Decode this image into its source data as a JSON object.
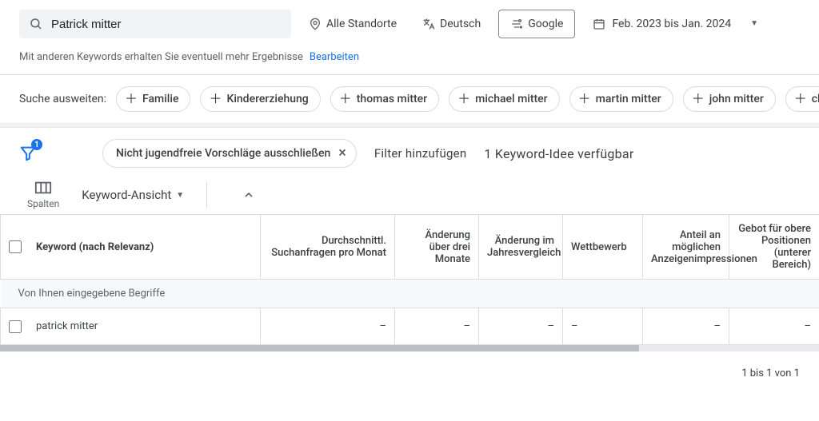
{
  "search": {
    "value": "Patrick mitter"
  },
  "targets": {
    "location": "Alle Standorte",
    "language": "Deutsch",
    "network": "Google",
    "date_range": "Feb. 2023 bis Jan. 2024"
  },
  "hint": {
    "text": "Mit anderen Keywords erhalten Sie eventuell mehr Ergebnisse",
    "edit": "Bearbeiten"
  },
  "expand": {
    "label": "Suche ausweiten:",
    "chips": [
      "Familie",
      "Kindererziehung",
      "thomas mitter",
      "michael mitter",
      "martin mitter",
      "john mitter",
      "christian"
    ]
  },
  "filters": {
    "badge": "1",
    "applied": "Nicht jugendfreie Vorschläge ausschließen",
    "add": "Filter hinzufügen",
    "ideas": "1 Keyword-Idee verfügbar"
  },
  "controls": {
    "columns": "Spalten",
    "view": "Keyword-Ansicht"
  },
  "table": {
    "headers": {
      "keyword": "Keyword (nach Relevanz)",
      "avg": "Durchschnittl. Suchanfragen pro Monat",
      "change3": "Änderung über drei Monate",
      "changeYoY": "Änderung im Jahresvergleich",
      "competition": "Wettbewerb",
      "impShare": "Anteil an möglichen Anzeigenimpressionen",
      "bidTop": "Gebot für obere Positionen (unterer Bereich)"
    },
    "section": "Von Ihnen eingegebene Begriffe",
    "rows": [
      {
        "keyword": "patrick mitter",
        "avg": "–",
        "change3": "–",
        "changeYoY": "–",
        "competition": "–",
        "impShare": "–",
        "bidTop": "–"
      }
    ]
  },
  "pager": "1 bis 1 von 1"
}
